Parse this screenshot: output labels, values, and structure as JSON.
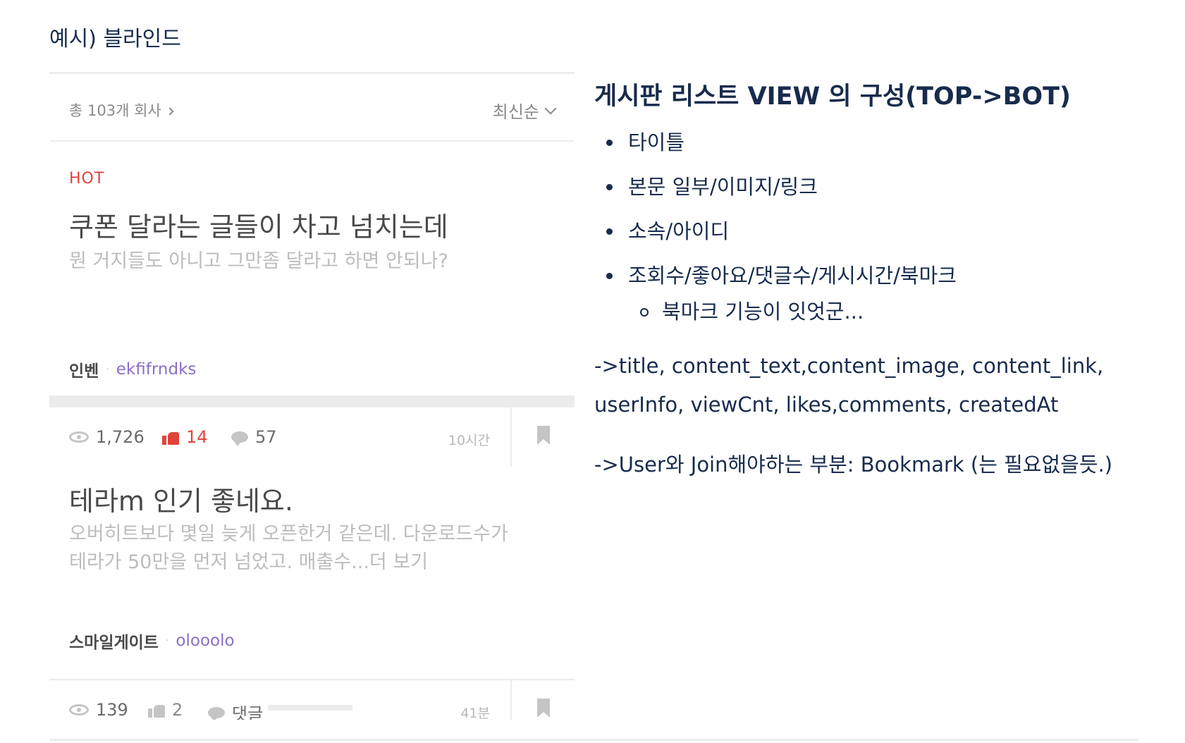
{
  "page": {
    "heading": "예시) 블라인드"
  },
  "app": {
    "list_header": {
      "count_text": "총 103개 회사",
      "sort_label": "최신순"
    },
    "posts": [
      {
        "hot_label": "HOT",
        "title": "쿠폰 달라는 글들이 차고 넘치는데",
        "excerpt": "뭔 거지들도 아니고  그만좀 달라고 하면 안되나?",
        "company": "인벤",
        "separator": "·",
        "user_id": "ekfifrndks",
        "views": "1,726",
        "likes": "14",
        "comments": "57",
        "time": "10시간"
      },
      {
        "title": "테라m 인기  좋네요.",
        "excerpt": "오버히트보다 몇일 늦게 오픈한거 같은데.  다운로드수가\n테라가 50만을 먼저 넘었고.  매출수...더 보기",
        "company": "스마일게이트",
        "separator": "·",
        "user_id": "olooolo",
        "views": "139",
        "likes": "2",
        "comments": "댓글",
        "time": "41분"
      }
    ],
    "colors": {
      "hot": "#e0433a",
      "user_id": "#8a6fc9",
      "like_active": "#e0433a"
    },
    "icons": [
      "eye-icon",
      "thumbs-up-icon",
      "comment-icon",
      "bookmark-icon",
      "chevron-down-icon",
      "chevron-right-icon"
    ]
  },
  "notes": {
    "title": "게시판 리스트 VIEW 의 구성(TOP->BOT)",
    "bullets": [
      "타이틀",
      "본문 일부/이미지/링크",
      "소속/아이디",
      "조회수/좋아요/댓글수/게시시간/북마크"
    ],
    "sub_bullets": [
      "북마크 기능이 잇엇군..."
    ],
    "paragraph_1": "->title, content_text,content_image, content_link, userInfo, viewCnt, likes,comments, createdAt",
    "paragraph_2": "->User와 Join해야하는 부분: Bookmark (는 필요없을듯.)"
  }
}
